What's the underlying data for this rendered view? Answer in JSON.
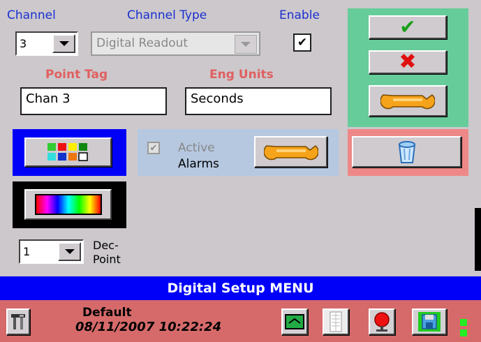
{
  "channel": {
    "label": "Channel",
    "value": "3"
  },
  "channel_type": {
    "label": "Channel Type",
    "value": "Digital Readout"
  },
  "enable": {
    "label": "Enable",
    "checked": true
  },
  "point_tag": {
    "label": "Point Tag",
    "value": "Chan 3"
  },
  "eng_units": {
    "label": "Eng Units",
    "value": "Seconds"
  },
  "alarms": {
    "active_label": "Active",
    "alarms_label": "Alarms",
    "checked": true
  },
  "dec_point": {
    "value": "1",
    "label_line1": "Dec-",
    "label_line2": "Point"
  },
  "menu_title": "Digital Setup MENU",
  "status": {
    "profile": "Default",
    "datetime": "08/11/2007 10:22:24"
  },
  "icons": {
    "ok": "check-icon",
    "cancel": "x-icon",
    "tools": "wrench-icon",
    "trash": "trash-icon",
    "palette": "color-grid-icon",
    "gradient": "spectrum-icon",
    "settings": "tools-icon",
    "transfer": "transfer-icon",
    "bars": "bar-graph-icon",
    "alarm": "alarm-bell-icon",
    "save": "save-icon"
  },
  "colors": {
    "accent_blue": "#0000f8",
    "status_bar": "#d66a6a",
    "ok_panel": "#66cc99",
    "delete_panel": "#ee8888"
  }
}
